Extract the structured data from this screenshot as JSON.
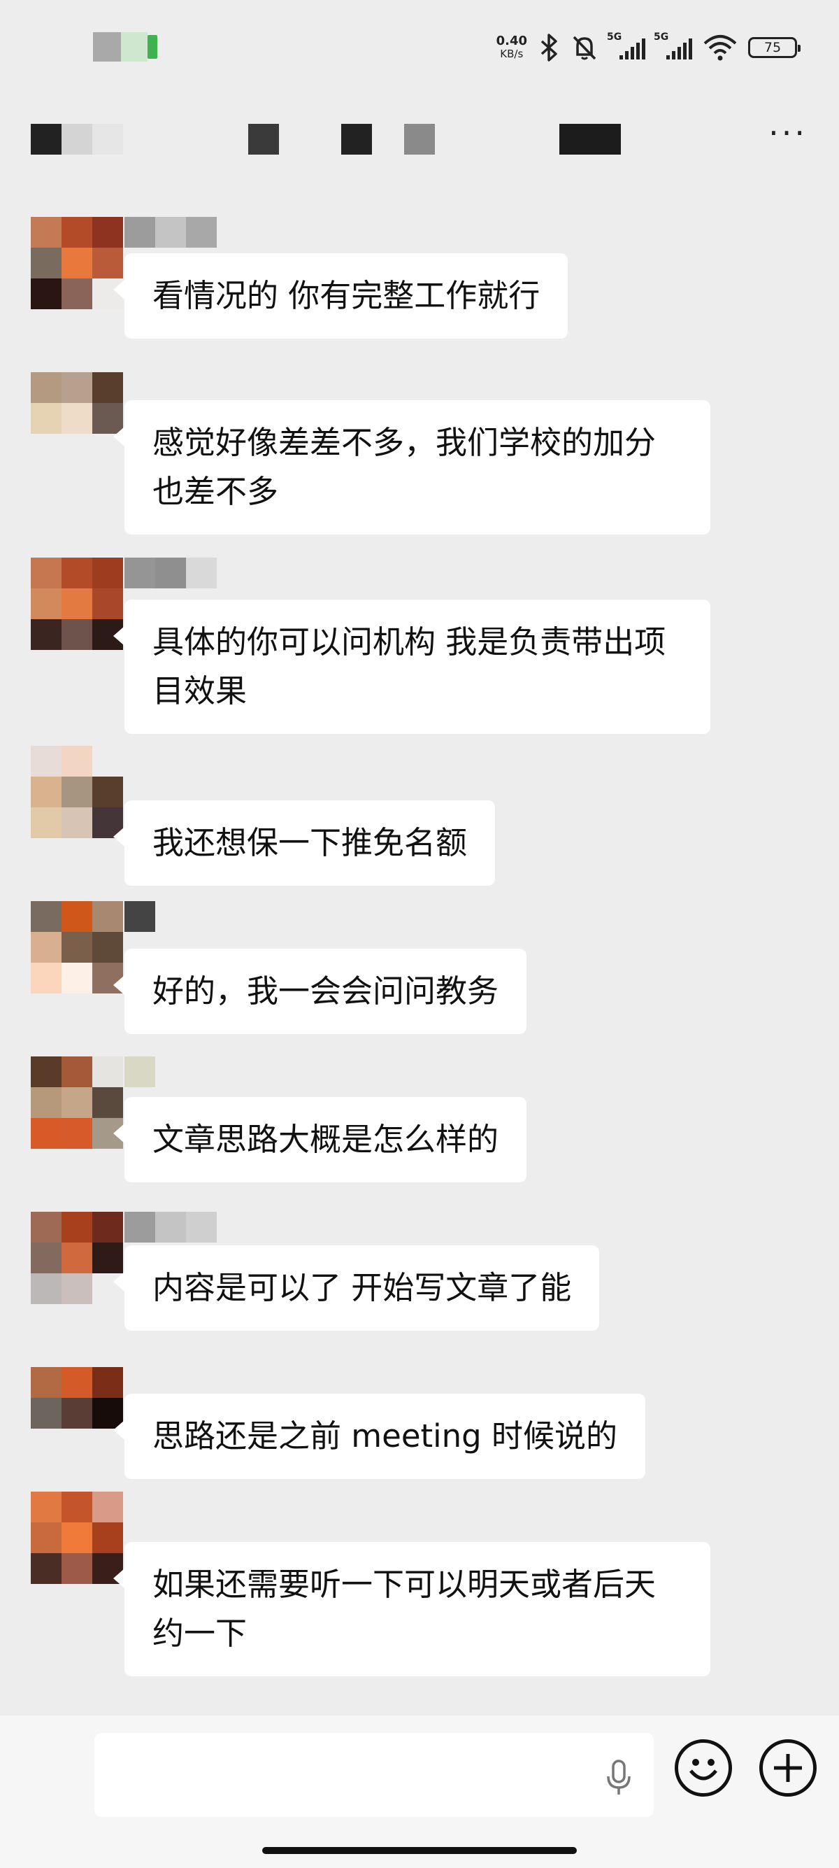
{
  "status_bar": {
    "net_speed_value": "0.40",
    "net_speed_unit": "KB/s",
    "sim1_label": "5G",
    "sim2_label": "5G",
    "battery": "75",
    "icons": [
      "bluetooth-icon",
      "mute-bell-icon",
      "signal-icon",
      "signal-icon",
      "wifi-icon",
      "battery-icon"
    ]
  },
  "header": {
    "more_label": "···"
  },
  "messages": [
    {
      "text": "看情况的 你有完整工作就行"
    },
    {
      "text": "感觉好像差差不多，我们学校的加分也差不多"
    },
    {
      "text": "具体的你可以问机构 我是负责带出项目效果"
    },
    {
      "text": "我还想保一下推免名额"
    },
    {
      "text": "好的，我一会会问问教务"
    },
    {
      "text": "文章思路大概是怎么样的"
    },
    {
      "text": "内容是可以了 开始写文章了能"
    },
    {
      "text": "思路还是之前 meeting 时候说的"
    },
    {
      "text": "如果还需要听一下可以明天或者后天约一下"
    }
  ],
  "input": {
    "placeholder": "",
    "icons": [
      "microphone-icon",
      "emoji-icon",
      "plus-icon"
    ]
  },
  "colors": {
    "background": "#ededed",
    "bubble": "#ffffff",
    "input_bar": "#f6f6f6"
  }
}
